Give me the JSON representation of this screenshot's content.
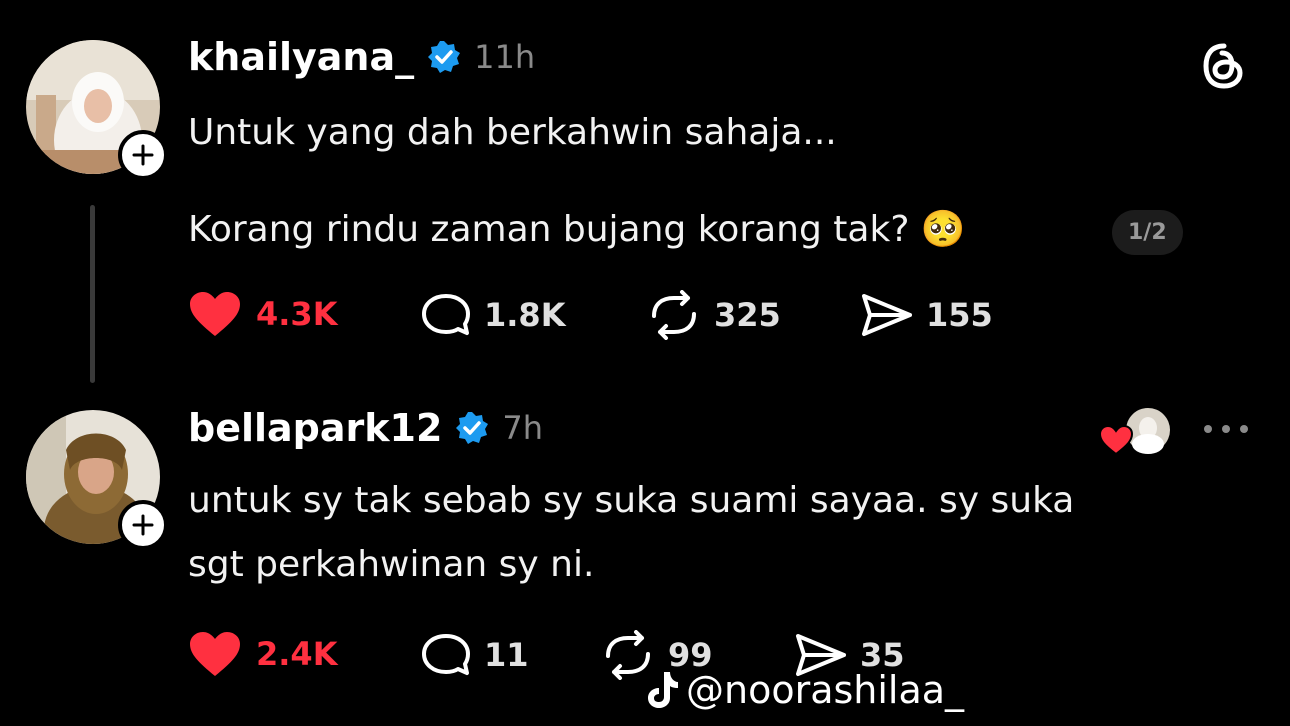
{
  "posts": [
    {
      "username": "khailyana_",
      "time": "11h",
      "lines": [
        "Untuk yang dah berkahwin sahaja...",
        "Korang rindu zaman bujang korang tak? 🥺"
      ],
      "page_indicator": "1/2",
      "likes": "4.3K",
      "replies": "1.8K",
      "reposts": "325",
      "shares": "155"
    },
    {
      "username": "bellapark12",
      "time": "7h",
      "lines": [
        "untuk sy tak sebab sy suka suami sayaa. sy suka",
        "sgt perkahwinan sy ni."
      ],
      "likes": "2.4K",
      "replies": "11",
      "reposts": "99",
      "shares": "35"
    }
  ],
  "watermark": "@noorashilaa_",
  "icons": {
    "app_logo": "threads-logo-icon",
    "verified": "verified-badge-icon",
    "like": "heart-icon",
    "reply": "comment-icon",
    "repost": "repost-icon",
    "share": "send-icon",
    "more": "more-dots-icon",
    "follow": "plus-icon"
  },
  "colors": {
    "background": "#000000",
    "like_active": "#ff3040",
    "verified": "#1d9bf0",
    "muted": "#8a8a8a"
  }
}
